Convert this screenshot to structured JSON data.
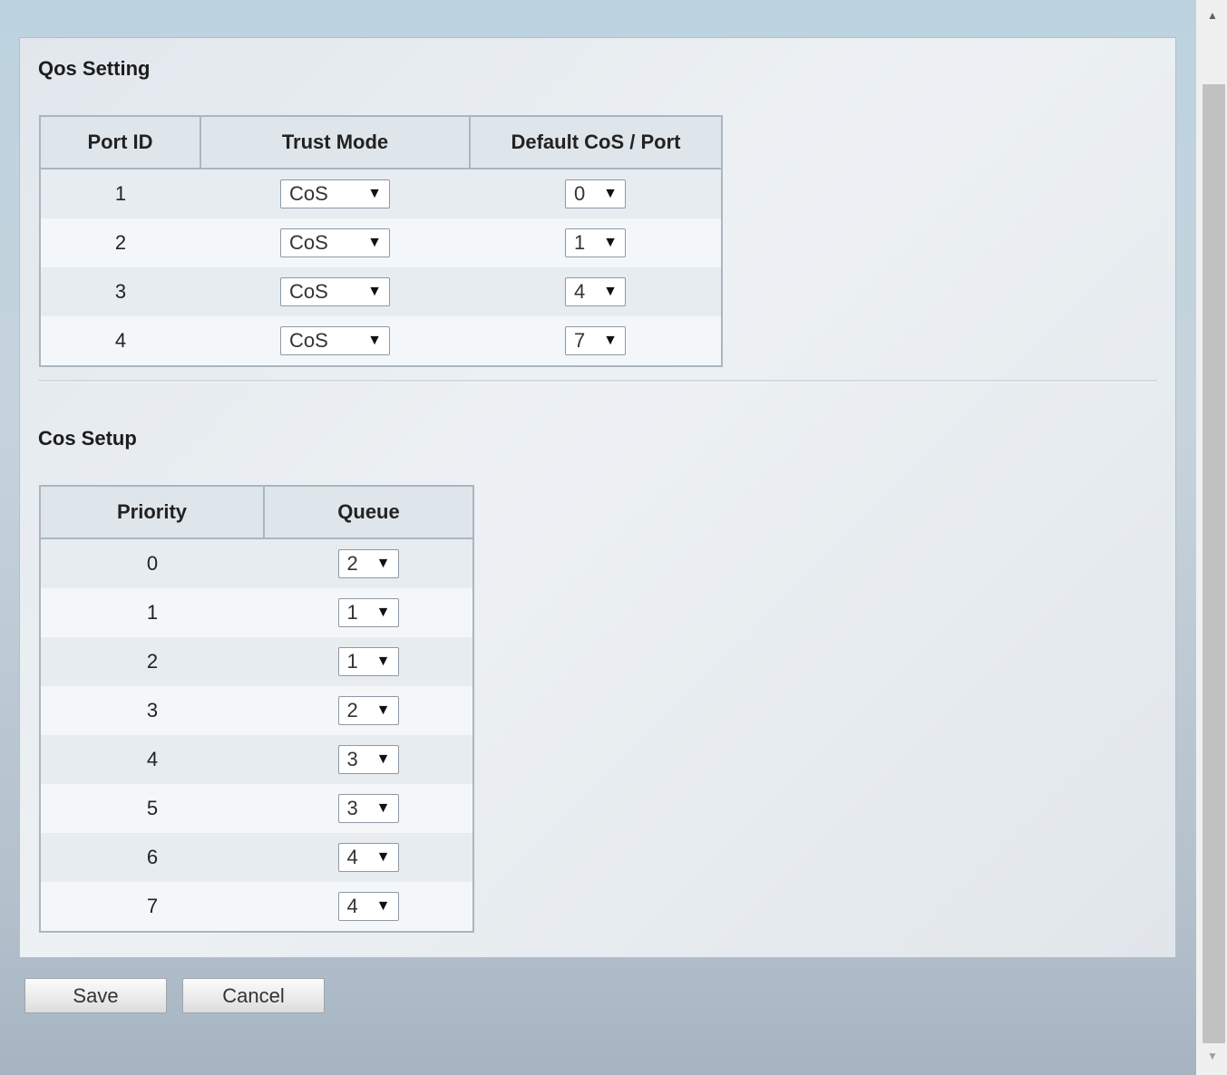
{
  "qos_setting": {
    "title": "Qos Setting",
    "headers": [
      "Port ID",
      "Trust Mode",
      "Default CoS / Port"
    ],
    "rows": [
      {
        "port": "1",
        "trust_mode": "CoS",
        "default_cos": "0"
      },
      {
        "port": "2",
        "trust_mode": "CoS",
        "default_cos": "1"
      },
      {
        "port": "3",
        "trust_mode": "CoS",
        "default_cos": "4"
      },
      {
        "port": "4",
        "trust_mode": "CoS",
        "default_cos": "7"
      }
    ]
  },
  "cos_setup": {
    "title": "Cos Setup",
    "headers": [
      "Priority",
      "Queue"
    ],
    "rows": [
      {
        "priority": "0",
        "queue": "2"
      },
      {
        "priority": "1",
        "queue": "1"
      },
      {
        "priority": "2",
        "queue": "1"
      },
      {
        "priority": "3",
        "queue": "2"
      },
      {
        "priority": "4",
        "queue": "3"
      },
      {
        "priority": "5",
        "queue": "3"
      },
      {
        "priority": "6",
        "queue": "4"
      },
      {
        "priority": "7",
        "queue": "4"
      }
    ]
  },
  "buttons": {
    "save": "Save",
    "cancel": "Cancel"
  },
  "icons": {
    "dropdown": "dropdown-arrow-icon",
    "scroll_up": "scroll-up-arrow-icon",
    "scroll_down": "scroll-down-arrow-icon"
  }
}
